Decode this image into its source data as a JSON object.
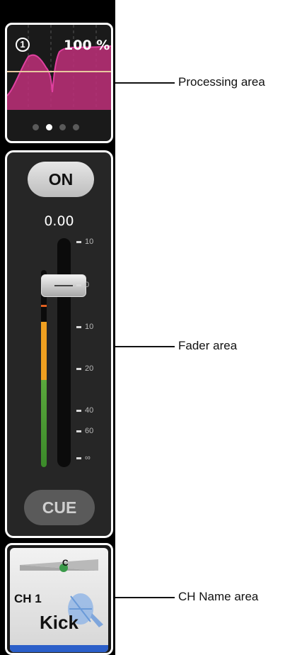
{
  "processing": {
    "number": "1",
    "percent": "100 %",
    "page_dots": [
      false,
      true,
      false,
      false
    ],
    "curve_color": "#c0307a"
  },
  "fader": {
    "on_label": "ON",
    "value": "0.00",
    "level_db": 0.0,
    "cue_label": "CUE",
    "scale": [
      "10",
      "0",
      "10",
      "20",
      "40",
      "60",
      "∞"
    ]
  },
  "channel": {
    "pan": "C",
    "number": "CH 1",
    "name": "Kick",
    "icon": "kick-drum-icon",
    "color": "#2b5fc9"
  },
  "callouts": {
    "processing": "Processing area",
    "fader": "Fader area",
    "chname": "CH Name area"
  }
}
